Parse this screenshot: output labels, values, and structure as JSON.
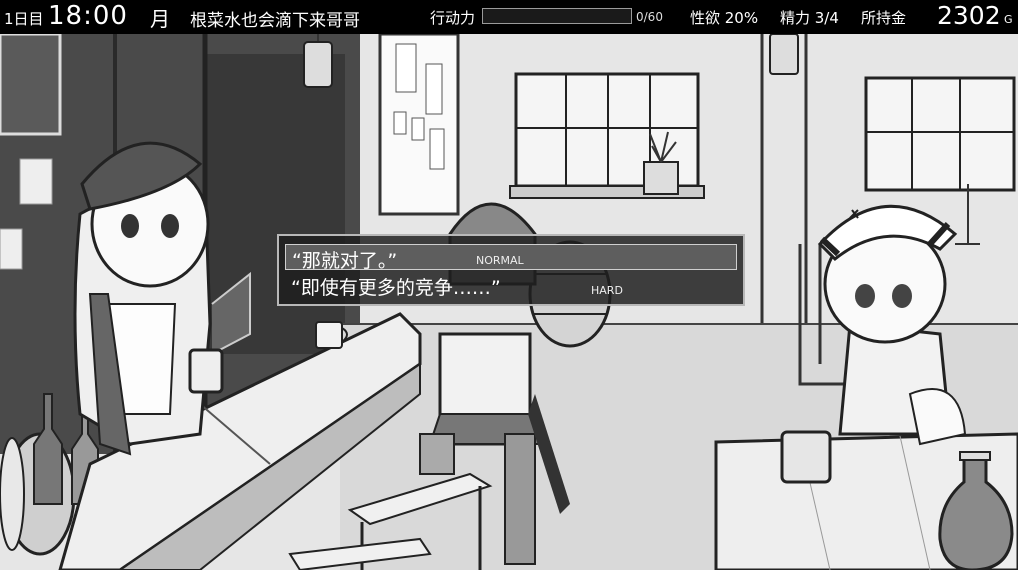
{
  "hud": {
    "day": "1日目",
    "time": "18:00",
    "month": "月",
    "location": "根菜水也会滴下来哥哥",
    "action_points_label": "行动力",
    "action_points_value": "0/60",
    "action_points_fraction": 0.0,
    "lust": "性欲 20%",
    "stamina": "精力 3/4",
    "money_label": "所持金",
    "money": "2302",
    "currency": "G"
  },
  "dialogue": {
    "choices": [
      {
        "text": "“那就对了。”",
        "tag": "NORMAL"
      },
      {
        "text": "“即使有更多的竞争……”",
        "tag": "HARD"
      }
    ]
  }
}
